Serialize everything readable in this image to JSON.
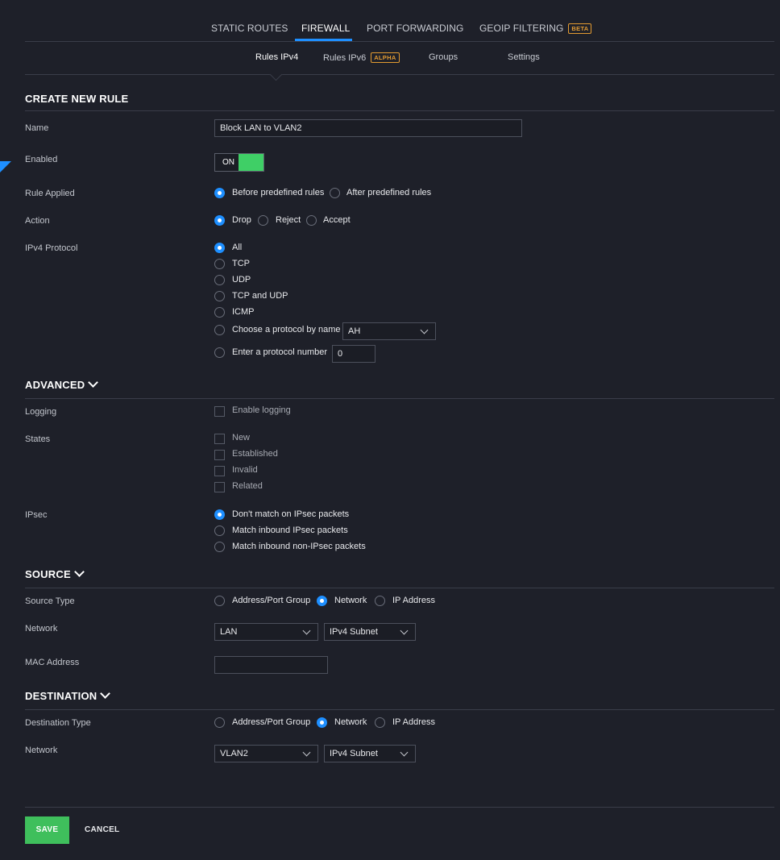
{
  "top_tabs": [
    "STATIC ROUTES",
    "FIREWALL",
    "PORT FORWARDING",
    "GEOIP FILTERING"
  ],
  "top_tab_badge": "BETA",
  "sub_tabs": [
    "Rules IPv4",
    "Rules IPv6",
    "Groups",
    "Settings"
  ],
  "sub_tab_badge": "ALPHA",
  "create": {
    "title": "CREATE NEW RULE",
    "name_label": "Name",
    "name_value": "Block LAN to VLAN2",
    "enabled_label": "Enabled",
    "enabled_value": "ON",
    "rule_applied_label": "Rule Applied",
    "rule_applied_options": [
      "Before predefined rules",
      "After predefined rules"
    ],
    "action_label": "Action",
    "action_options": [
      "Drop",
      "Reject",
      "Accept"
    ],
    "protocol_label": "IPv4 Protocol",
    "protocol_options": [
      "All",
      "TCP",
      "UDP",
      "TCP and UDP",
      "ICMP",
      "Choose a protocol by name",
      "Enter a protocol number"
    ],
    "protocol_name_value": "AH",
    "protocol_number_value": "0"
  },
  "advanced": {
    "title": "ADVANCED",
    "logging_label": "Logging",
    "logging_option": "Enable logging",
    "states_label": "States",
    "states_options": [
      "New",
      "Established",
      "Invalid",
      "Related"
    ],
    "ipsec_label": "IPsec",
    "ipsec_options": [
      "Don't match on IPsec packets",
      "Match inbound IPsec packets",
      "Match inbound non-IPsec packets"
    ]
  },
  "source": {
    "title": "SOURCE",
    "type_label": "Source Type",
    "type_options": [
      "Address/Port Group",
      "Network",
      "IP Address"
    ],
    "network_label": "Network",
    "network_value": "LAN",
    "network_subnet": "IPv4 Subnet",
    "mac_label": "MAC Address",
    "mac_value": ""
  },
  "destination": {
    "title": "DESTINATION",
    "type_label": "Destination Type",
    "type_options": [
      "Address/Port Group",
      "Network",
      "IP Address"
    ],
    "network_label": "Network",
    "network_value": "VLAN2",
    "network_subnet": "IPv4 Subnet"
  },
  "buttons": {
    "save": "SAVE",
    "cancel": "CANCEL"
  },
  "colors": {
    "accent": "#1e8fff",
    "success": "#3fcf66",
    "badge": "#e39b32",
    "background": "#1e2029"
  }
}
